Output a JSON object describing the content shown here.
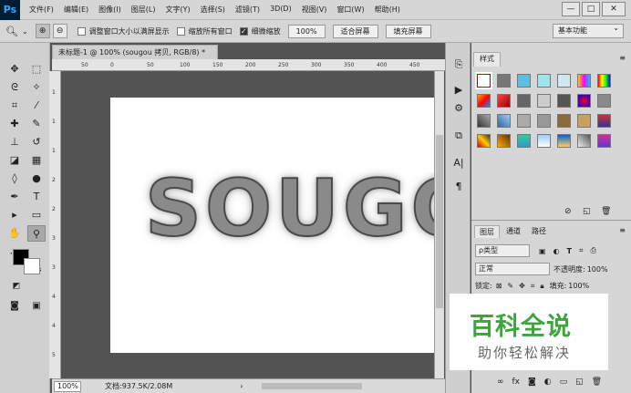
{
  "app": {
    "logo": "Ps"
  },
  "menu": [
    "文件(F)",
    "编辑(E)",
    "图像(I)",
    "图层(L)",
    "文字(Y)",
    "选择(S)",
    "滤镜(T)",
    "3D(D)",
    "视图(V)",
    "窗口(W)",
    "帮助(H)"
  ],
  "window_controls": {
    "minimize": "—",
    "maximize": "□",
    "close": "✕"
  },
  "options": {
    "zoom_in": "⊕",
    "zoom_out": "⊖",
    "resize_windows": "调整窗口大小以满屏显示",
    "zoom_all": "缩放所有窗口",
    "scrubby_zoom": "细微缩放",
    "zoom_value": "100%",
    "fit_screen": "适合屏幕",
    "fill_screen": "填充屏幕",
    "workspace": "基本功能"
  },
  "document": {
    "tab_title": "未标题-1 @ 100% (sougou 拷贝, RGB/8) *",
    "close": "×",
    "canvas_text": "SOUGO",
    "ruler_h_labels": [
      "50",
      "0",
      "50",
      "100",
      "150",
      "200",
      "250",
      "300",
      "350",
      "400",
      "450"
    ],
    "ruler_v_labels": [
      "1",
      "1",
      "1",
      "2",
      "2",
      "3",
      "3",
      "4",
      "4",
      "5"
    ]
  },
  "status": {
    "zoom": "100%",
    "doc_info": "文档:937.5K/2.08M"
  },
  "styles_panel": {
    "tab": "样式"
  },
  "layers_panel": {
    "tabs": [
      "图层",
      "通道",
      "路径"
    ],
    "filter_kind": "ρ类型",
    "blend_mode": "正常",
    "opacity_label": "不透明度:",
    "opacity_value": "100%",
    "lock_label": "锁定:",
    "fill_label": "填充:",
    "fill_value": "100%"
  },
  "watermark": {
    "line1": "百科全说",
    "line2": "助你轻松解决"
  },
  "colors": {
    "accent": "#31a8ff",
    "watermark_green": "#3aa63c"
  }
}
